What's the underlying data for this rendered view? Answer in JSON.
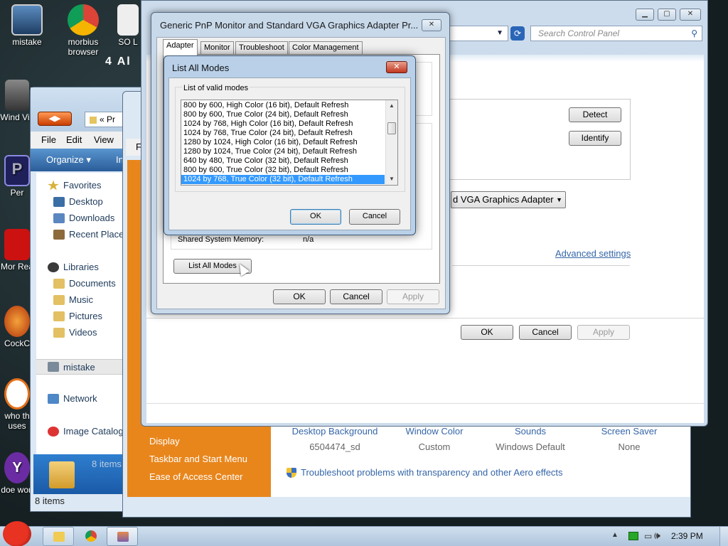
{
  "desktop": {
    "icons": [
      {
        "label": "mistake",
        "name": "desktop-icon-mistake"
      },
      {
        "label": "morbius browser",
        "name": "desktop-icon-morbius-browser"
      },
      {
        "label": "SO L",
        "name": "desktop-icon-so-l"
      },
      {
        "label": "Wind Vis",
        "name": "desktop-icon-wind-vis"
      },
      {
        "label": "Per",
        "name": "desktop-icon-per"
      },
      {
        "label": "Mor Rea",
        "name": "desktop-icon-mor-rea"
      },
      {
        "label": "CockC",
        "name": "desktop-icon-cockc"
      },
      {
        "label": "who th uses",
        "name": "desktop-icon-who-th-uses"
      },
      {
        "label": "doe worl",
        "name": "desktop-icon-doe-worl"
      }
    ],
    "overlay_text": "4 Al"
  },
  "explorer": {
    "address_text": "« Pr",
    "menu": [
      "File",
      "Edit",
      "View"
    ],
    "organize_label": "Organize ▾",
    "toolbar_right_label": "In",
    "favorites_label": "Favorites",
    "favorites": [
      "Desktop",
      "Downloads",
      "Recent Place"
    ],
    "libraries_label": "Libraries",
    "libraries": [
      "Documents",
      "Music",
      "Pictures",
      "Videos"
    ],
    "homegroup_label": "mistake",
    "network_label": "Network",
    "image_catalog_label": "Image Catalog",
    "items_count_overlay": "8 items",
    "status_bar": "8 items"
  },
  "explorer2": {
    "menu_letter": "F"
  },
  "personalization": {
    "left_links": [
      "Display",
      "Taskbar and Start Menu",
      "Ease of Access Center"
    ],
    "grid_titles": [
      "Desktop Background",
      "Window Color",
      "Sounds",
      "Screen Saver"
    ],
    "grid_values": [
      "6504474_sd",
      "Custom",
      "Windows Default",
      "None"
    ],
    "troubleshoot_link": "Troubleshoot problems with transparency and other Aero effects"
  },
  "control_panel": {
    "search_placeholder": "Search Control Panel",
    "detect_label": "Detect",
    "identify_label": "Identify",
    "adapter_select_value": "d VGA Graphics Adapter",
    "advanced_settings_label": "Advanced settings",
    "ok_label": "OK",
    "cancel_label": "Cancel",
    "apply_label": "Apply"
  },
  "properties_dialog": {
    "title": "Generic PnP Monitor and Standard VGA Graphics Adapter Pr...",
    "tabs": [
      "Adapter",
      "Monitor",
      "Troubleshoot",
      "Color Management"
    ],
    "shared_memory_label": "Shared System Memory:",
    "shared_memory_value": "n/a",
    "list_all_modes_label": "List All Modes",
    "ok_label": "OK",
    "cancel_label": "Cancel",
    "apply_label": "Apply"
  },
  "list_modes_dialog": {
    "title": "List All Modes",
    "group_label": "List of valid modes",
    "modes": [
      "800 by 600, High Color (16 bit), Default Refresh",
      "800 by 600, True Color (24 bit), Default Refresh",
      "1024 by 768, High Color (16 bit), Default Refresh",
      "1024 by 768, True Color (24 bit), Default Refresh",
      "1280 by 1024, High Color (16 bit), Default Refresh",
      "1280 by 1024, True Color (24 bit), Default Refresh",
      "640 by 480, True Color (32 bit), Default Refresh",
      "800 by 600, True Color (32 bit), Default Refresh",
      "1024 by 768, True Color (32 bit), Default Refresh"
    ],
    "selected_index": 8,
    "ok_label": "OK",
    "cancel_label": "Cancel"
  },
  "taskbar": {
    "clock": "2:39 PM",
    "colors": {
      "taskbar": "#bfd2e4",
      "accent_orange": "#e8861c",
      "selection": "#3399ff"
    }
  }
}
